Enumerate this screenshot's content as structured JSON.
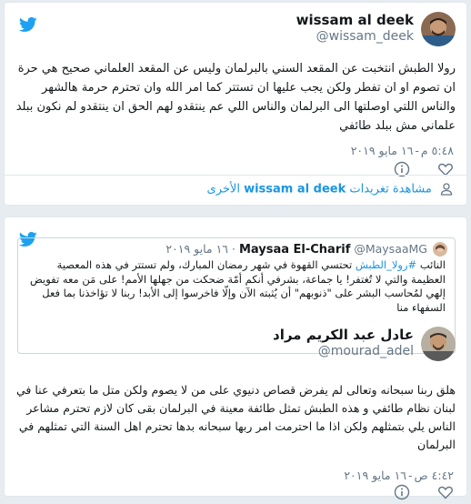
{
  "tweet1": {
    "name": "wissam al deek",
    "handle": "@wissam_deek",
    "text": "رولا الطبش انتخبت عن المقعد السني بالبرلمان وليس عن المقعد العلماني صحيح هي حرة ان تصوم او ان تفطر ولكن يجب عليها ان تستتر كما امر الله وان تحترم حرمة هالشهر والناس اللتي اوصلتها الى البرلمان والناس اللي عم ينتقدو لهم الحق ان ينتقدو لم نكون ببلد علماني مش ببلد طائفي",
    "time": "٥:٤٨ م",
    "date": "١٦ مايو ٢٠١٩",
    "more_prefix": "مشاهدة تغريدات",
    "more_name": "wissam al deek",
    "more_suffix": "الأخرى"
  },
  "tweet2": {
    "name": "عادل عبد الكريم مراد",
    "handle": "@mourad_adel",
    "text": "هلق ربنا سبحانه وتعالى لم يفرض قصاص دنيوي على من لا يصوم ولكن متل ما بتعرفي عنا في لبنان نظام طائفي و هذه الطبش تمثل طائفة معينة في البرلمان بقى كان لازم تحترم مشاعر الناس يلي بتمثلهم ولكن اذا ما احترمت امر ربها سبحانه بدها تحترم اهل السنة التي تمثلهم في البرلمان",
    "time": "٤:٤٢ ص",
    "date": "١٦ مايو ٢٠١٩"
  },
  "quoted": {
    "name": "Maysaa El-Charif",
    "handle": "@MaysaaMG",
    "date": "١٦ مايو ٢٠١٩",
    "line1_prefix": "النائب ",
    "hashtag": "#رولا_الطبش",
    "line1_rest": " تحتسي القهوة في شهر رمضان المبارك، ولم تستتر في هذه المعصية العظيمة والتي لا تُغتفر! يا جماعة، بشرفي أنكم أمّة ضحكت من جهلها الأمم! على مَن معه تفويض إلهي لمُحاسب البشر على \"ذنوبهم\" أن يُثبته الآن وإلّا فاخرسوا إلى الأبد! ربنا لا تؤاخذنا بما فعل السفهاء منا"
  },
  "colors": {
    "accent": "#1b95e0",
    "twitter_blue": "#1da1f2",
    "muted": "#657786"
  }
}
